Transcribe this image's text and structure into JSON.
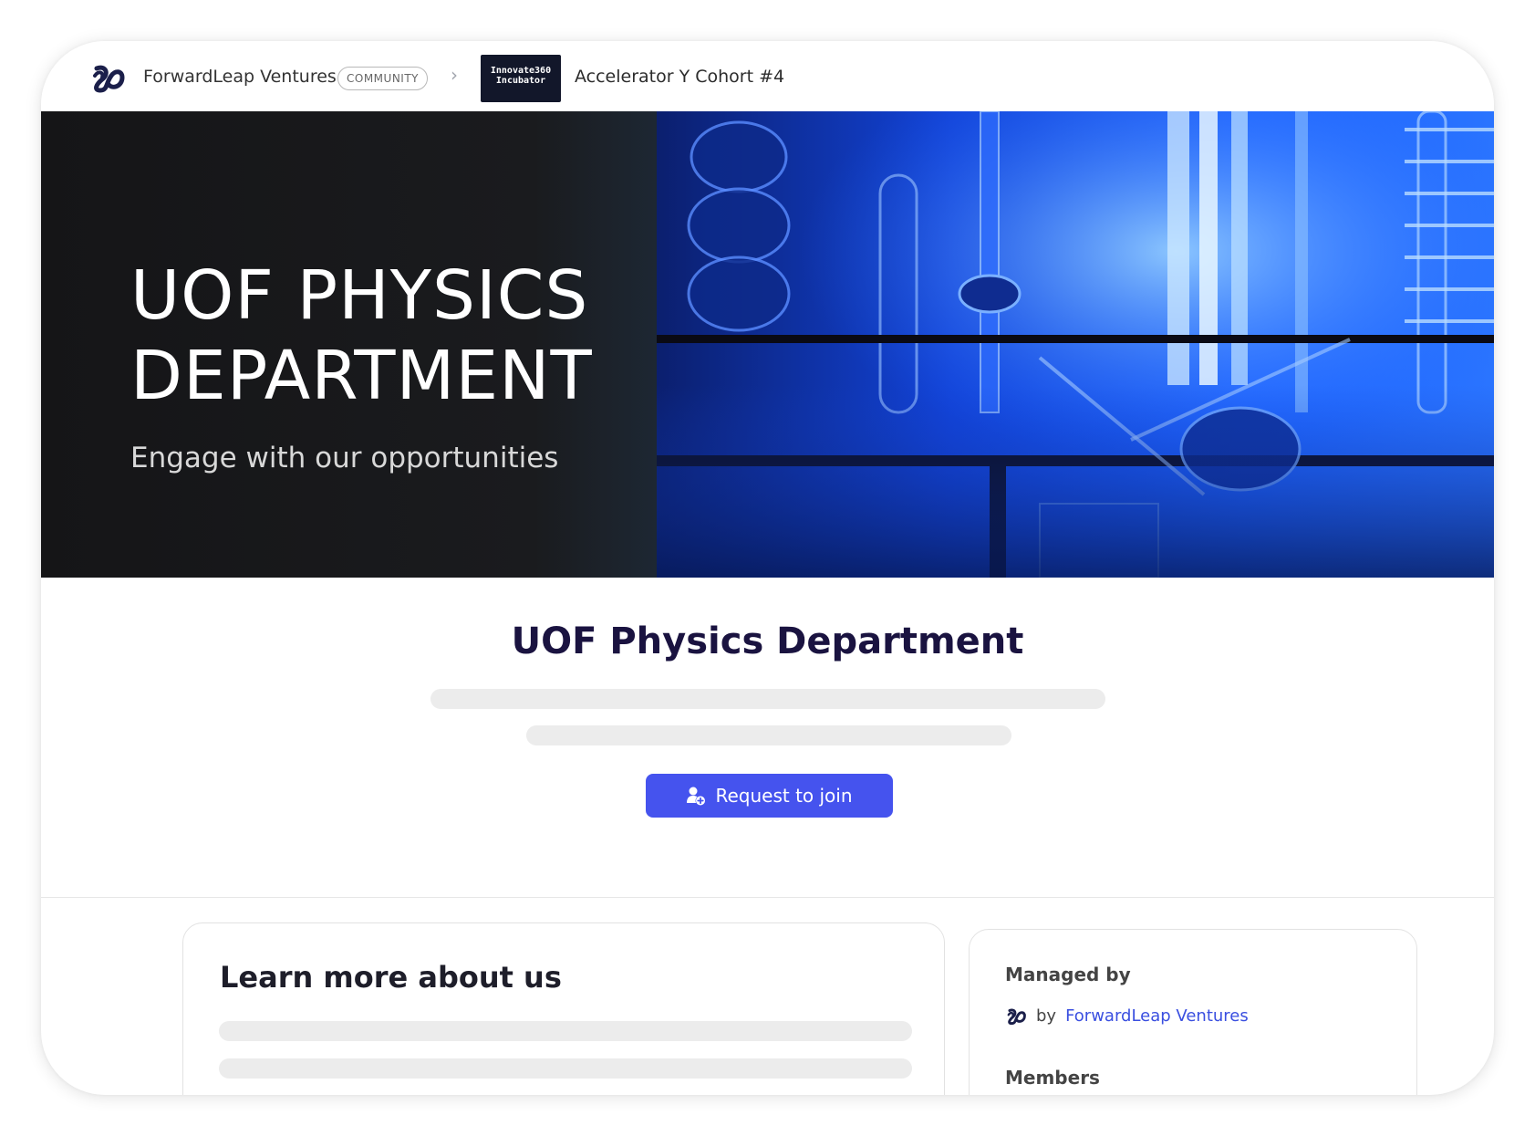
{
  "header": {
    "brand_name": "ForwardLeap Ventures",
    "badge": "COMMUNITY",
    "separator": "›",
    "cohort_logo_line1": "Innovate360",
    "cohort_logo_line2": "Incubator",
    "cohort_name": "Accelerator Y Cohort #4"
  },
  "hero": {
    "title_line1": "UOF PHYSICS",
    "title_line2": "DEPARTMENT",
    "subtitle": "Engage with our opportunities"
  },
  "main": {
    "title": "UOF Physics Department",
    "join_label": "Request to join"
  },
  "about": {
    "title": "Learn more about us"
  },
  "sidebar": {
    "managed_label": "Managed by",
    "by_text": "by",
    "manager_name": "ForwardLeap Ventures",
    "members_label": "Members"
  },
  "colors": {
    "primary_button": "#4553ee",
    "title": "#1a1340",
    "link": "#3a4fe0",
    "hero_blue": "#1f5bff"
  },
  "icons": {
    "brand": "forwardleap-logo-icon",
    "separator": "chevron-right-icon",
    "join": "user-add-icon"
  }
}
